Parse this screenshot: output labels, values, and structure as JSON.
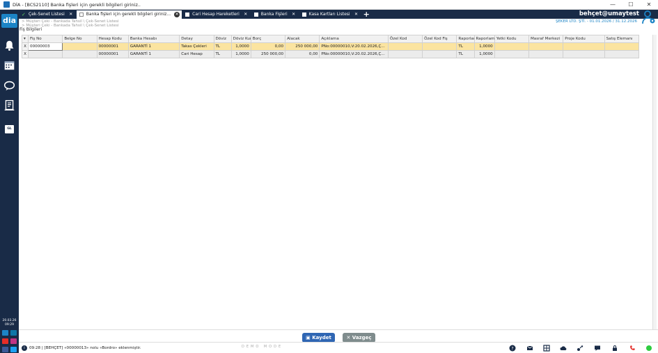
{
  "window": {
    "title": "DİA - [BCS2110] Banka fişleri için gerekli bilgileri giriniz..",
    "min": "—",
    "max": "☐",
    "close": "✕"
  },
  "sidebar": {
    "logo": "dia",
    "gl_label": "GL",
    "date": "20.03.26",
    "time": "09:29"
  },
  "tabs": [
    {
      "label": "Çek-Senet Listesi"
    },
    {
      "label": "Banka fişleri için gerekli bilgileri giriniz..."
    },
    {
      "label": "Cari Hesap Hareketleri"
    },
    {
      "label": "Banka Fişleri"
    },
    {
      "label": "Kasa Kartları Listesi"
    }
  ],
  "add_tab": "+",
  "user": {
    "name": "behçet@umaytest"
  },
  "breadcrumb": {
    "line1": "> Müşteri Çeki - Bankada Tahsil \\ Çek-Senet Listesi",
    "line2": "> Müşteri Çeki - Bankada Tahsil \\ Çek-Senet Listesi"
  },
  "company": "ŞEKER LTD. ŞTİ. - 01.01.2026 / 31.12.2026",
  "section_title": "Fiş Bilgileri",
  "grid": {
    "headers": [
      "",
      "Fiş No",
      "Belge No",
      "Hesap Kodu",
      "Banka Hesabı",
      "Detay",
      "Döviz",
      "Döviz Kuru",
      "Borç",
      "Alacak",
      "Açıklama",
      "Özel Kod",
      "Özel Kod Fiş",
      "Raporlama",
      "Raporlama",
      "Yetki Kodu",
      "Masraf Merkezi",
      "Proje Kodu",
      "Satış Elemanı"
    ],
    "rows": [
      [
        "X",
        "00000003",
        "",
        "00000001",
        "GARANTİ 1",
        "Takas Çekleri",
        "TL",
        "1,0000",
        "0,00",
        "250 000,00",
        "PNo:00000010,V:20.02.2026,Ç...",
        "",
        "",
        "TL",
        "1,0000",
        "",
        "",
        "",
        ""
      ],
      [
        "X",
        "",
        "",
        "00000001",
        "GARANTİ 1",
        "Cari Hesap",
        "TL",
        "1,0000",
        "250 000,00",
        "0,00",
        "PNo:00000010,V:20.02.2026,Ç...",
        "",
        "",
        "TL",
        "1,0000",
        "",
        "",
        "",
        ""
      ]
    ]
  },
  "buttons": {
    "save": "Kaydet",
    "cancel": "Vazgeç"
  },
  "status": {
    "info": "i",
    "message": "09:28 | [BEHÇET] «00000013» nolu «Bordro» eklenmiştir.",
    "demo": "DEMO MODE"
  },
  "colors": {
    "sidebar": "#192b47",
    "accent": "#1c84c6",
    "selected_row": "#fbe4a0",
    "save": "#2f66b3",
    "cancel": "#7f8c8d"
  }
}
